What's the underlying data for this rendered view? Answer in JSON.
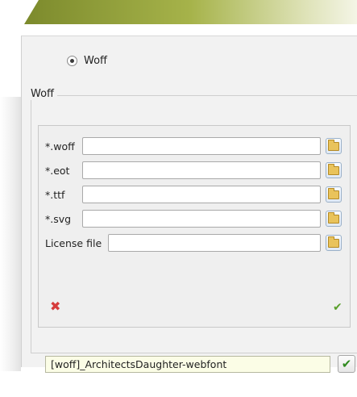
{
  "format_option": {
    "label": "Woff",
    "selected": true
  },
  "group": {
    "title": "Woff"
  },
  "fields": [
    {
      "label": "*.woff",
      "value": ""
    },
    {
      "label": "*.eot",
      "value": ""
    },
    {
      "label": "*.ttf",
      "value": ""
    },
    {
      "label": "*.svg",
      "value": ""
    },
    {
      "label": "License file",
      "value": ""
    }
  ],
  "icons": {
    "browse": "folder-open-icon",
    "cancel": "red-x-icon",
    "confirm": "green-check-icon"
  },
  "bottom": {
    "name_value": "[woff]_ArchitectsDaughter-webfont"
  },
  "colors": {
    "accent_green": "#7c8a2c",
    "cancel_red": "#d63c3c",
    "confirm_green": "#5aa02c"
  }
}
